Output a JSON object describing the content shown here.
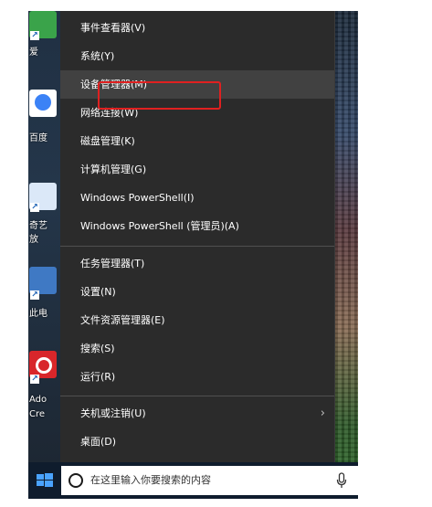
{
  "desktop": {
    "icons": [
      {
        "label": "爱",
        "name": "desktop-icon-aiqiyi"
      },
      {
        "label": "百度",
        "name": "desktop-icon-baidu"
      },
      {
        "label": "奇艺",
        "name": "desktop-icon-qiyi"
      },
      {
        "label": "放",
        "name": "desktop-icon-fang"
      },
      {
        "label": "此电",
        "name": "desktop-icon-this-pc"
      },
      {
        "label": "Ado",
        "name": "desktop-icon-adobe"
      },
      {
        "label": "Cre",
        "name": "desktop-icon-adobe-cre"
      }
    ]
  },
  "context_menu": {
    "items": [
      {
        "label": "事件查看器(V)"
      },
      {
        "label": "系统(Y)"
      },
      {
        "label": "设备管理器(M)",
        "highlighted": true
      },
      {
        "label": "网络连接(W)"
      },
      {
        "label": "磁盘管理(K)"
      },
      {
        "label": "计算机管理(G)"
      },
      {
        "label": "Windows PowerShell(I)"
      },
      {
        "label": "Windows PowerShell (管理员)(A)"
      },
      {
        "label": "任务管理器(T)"
      },
      {
        "label": "设置(N)"
      },
      {
        "label": "文件资源管理器(E)"
      },
      {
        "label": "搜索(S)"
      },
      {
        "label": "运行(R)"
      },
      {
        "label": "关机或注销(U)",
        "has_submenu": true
      },
      {
        "label": "桌面(D)"
      }
    ],
    "colors": {
      "background": "#2b2b2b",
      "hover": "#414141",
      "highlight_border": "#e02020"
    }
  },
  "taskbar": {
    "search_placeholder": "在这里输入你要搜索的内容",
    "start_icon": "windows-logo-icon",
    "mic_icon": "microphone-icon"
  }
}
